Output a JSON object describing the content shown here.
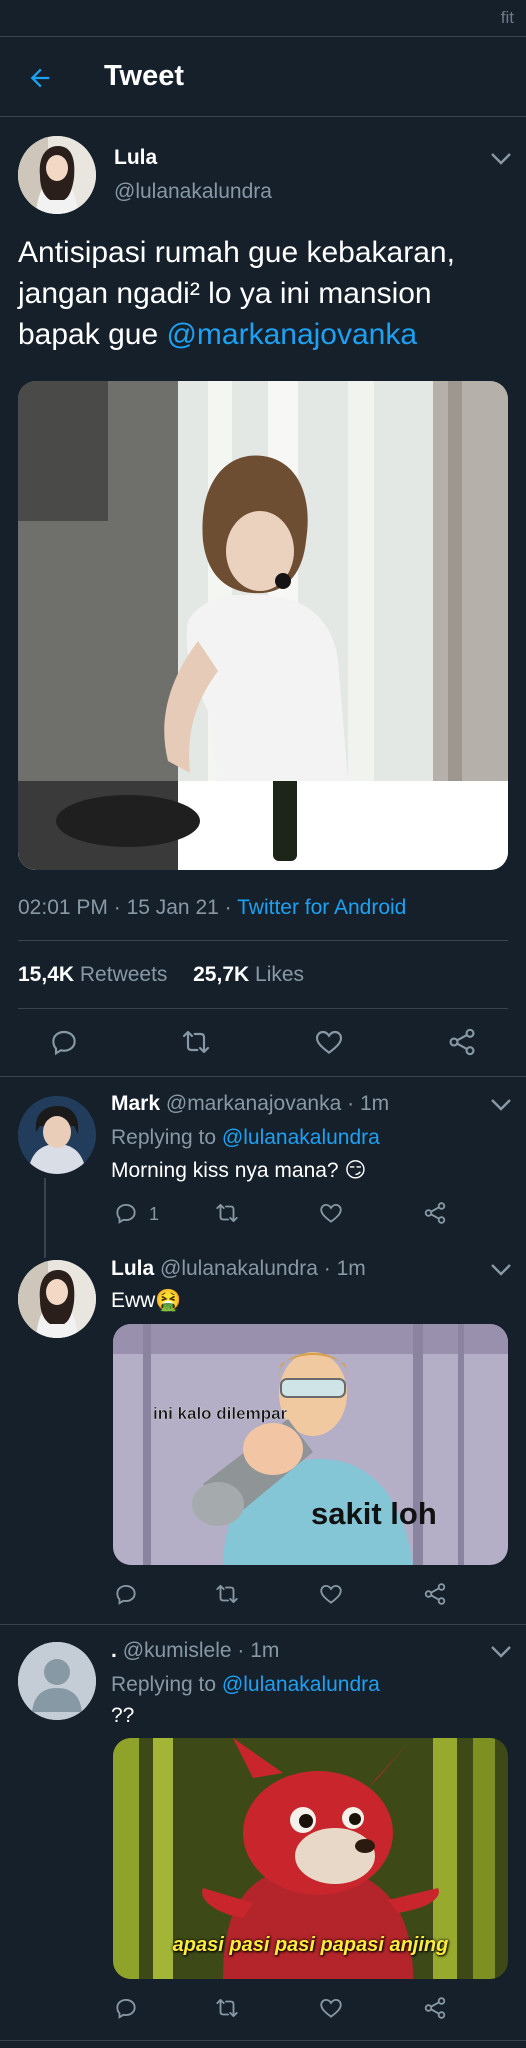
{
  "status_bar": {
    "label": "fit"
  },
  "header": {
    "title": "Tweet"
  },
  "main_tweet": {
    "display_name": "Lula",
    "handle": "@lulanakalundra",
    "text_plain": "Antisipasi rumah gue kebakaran, jangan ngadi² lo ya ini mansion bapak gue ",
    "mention": "@markanajovanka",
    "time": "02:01 PM",
    "date": "15 Jan 21",
    "source": "Twitter for Android",
    "retweets_count": "15,4K",
    "retweets_label": "Retweets",
    "likes_count": "25,7K",
    "likes_label": "Likes"
  },
  "replies": [
    {
      "display_name": "Mark",
      "handle": "@markanajovanka",
      "time": "1m",
      "replying_to_label": "Replying to",
      "replying_to": "@lulanakalundra",
      "text": "Morning kiss nya mana?",
      "emoji": "😏",
      "reply_count": "1"
    },
    {
      "display_name": "Lula",
      "handle": "@lulanakalundra",
      "time": "1m",
      "text": "Eww",
      "emoji": "🤮",
      "meme_text_top": "ini kalo dilempar",
      "meme_text_bottom": "sakit loh"
    },
    {
      "display_name": ".",
      "handle": "@kumislele",
      "time": "1m",
      "replying_to_label": "Replying to",
      "replying_to": "@lulanakalundra",
      "text": "??",
      "meme_caption": "apasi pasi pasi papasi anjing"
    }
  ],
  "colors": {
    "background": "#15202b",
    "accent": "#1da1f2",
    "muted": "#8899a6",
    "divider": "#38444d"
  }
}
